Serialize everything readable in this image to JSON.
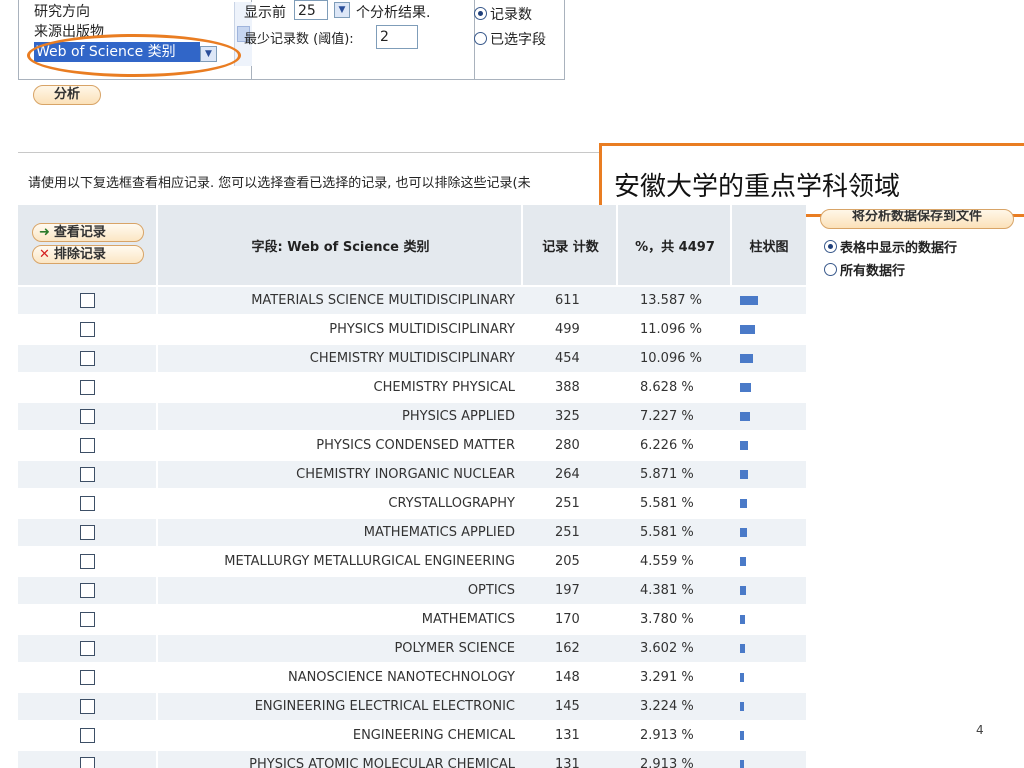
{
  "analysis_panel": {
    "field_options": [
      "研究方向",
      "来源出版物",
      "Web of Science 类别"
    ],
    "show_top_label": "显示前",
    "show_top_value": "25",
    "show_top_suffix": "个分析结果.",
    "min_records_label": "最少记录数 (阈值):",
    "min_records_value": "2",
    "sort_options": [
      "记录数",
      "已选字段"
    ],
    "analyze_button": "分析"
  },
  "instructions": "请使用以下复选框查看相应记录. 您可以选择查看已选择的记录, 也可以排除这些记录(未",
  "callout_text": "安徽大学的重点学科领域",
  "table": {
    "view_records_button": "查看记录",
    "exclude_records_button": "排除记录",
    "col_field": "字段: Web of Science 类别",
    "col_count": "记录 计数",
    "col_percent": "%，共 4497",
    "col_bar": "柱状图"
  },
  "save_panel": {
    "save_button": "将分析数据保存到文件",
    "options": [
      "表格中显示的数据行",
      "所有数据行"
    ]
  },
  "rows": [
    {
      "field": "MATERIALS SCIENCE MULTIDISCIPLINARY",
      "count": "611",
      "percent": "13.587 %",
      "pct": 13.587
    },
    {
      "field": "PHYSICS MULTIDISCIPLINARY",
      "count": "499",
      "percent": "11.096 %",
      "pct": 11.096
    },
    {
      "field": "CHEMISTRY MULTIDISCIPLINARY",
      "count": "454",
      "percent": "10.096 %",
      "pct": 10.096
    },
    {
      "field": "CHEMISTRY PHYSICAL",
      "count": "388",
      "percent": "8.628 %",
      "pct": 8.628
    },
    {
      "field": "PHYSICS APPLIED",
      "count": "325",
      "percent": "7.227 %",
      "pct": 7.227
    },
    {
      "field": "PHYSICS CONDENSED MATTER",
      "count": "280",
      "percent": "6.226 %",
      "pct": 6.226
    },
    {
      "field": "CHEMISTRY INORGANIC NUCLEAR",
      "count": "264",
      "percent": "5.871 %",
      "pct": 5.871
    },
    {
      "field": "CRYSTALLOGRAPHY",
      "count": "251",
      "percent": "5.581 %",
      "pct": 5.581
    },
    {
      "field": "MATHEMATICS APPLIED",
      "count": "251",
      "percent": "5.581 %",
      "pct": 5.581
    },
    {
      "field": "METALLURGY METALLURGICAL ENGINEERING",
      "count": "205",
      "percent": "4.559 %",
      "pct": 4.559
    },
    {
      "field": "OPTICS",
      "count": "197",
      "percent": "4.381 %",
      "pct": 4.381
    },
    {
      "field": "MATHEMATICS",
      "count": "170",
      "percent": "3.780 %",
      "pct": 3.78
    },
    {
      "field": "POLYMER SCIENCE",
      "count": "162",
      "percent": "3.602 %",
      "pct": 3.602
    },
    {
      "field": "NANOSCIENCE NANOTECHNOLOGY",
      "count": "148",
      "percent": "3.291 %",
      "pct": 3.291
    },
    {
      "field": "ENGINEERING ELECTRICAL ELECTRONIC",
      "count": "145",
      "percent": "3.224 %",
      "pct": 3.224
    },
    {
      "field": "ENGINEERING CHEMICAL",
      "count": "131",
      "percent": "2.913 %",
      "pct": 2.913
    },
    {
      "field": "PHYSICS ATOMIC MOLECULAR CHEMICAL",
      "count": "131",
      "percent": "2.913 %",
      "pct": 2.913
    }
  ],
  "page_number": "4",
  "colors": {
    "accent_orange": "#e97d22",
    "bar_blue": "#4a7ac8",
    "header_bg": "#e4e9ee"
  }
}
